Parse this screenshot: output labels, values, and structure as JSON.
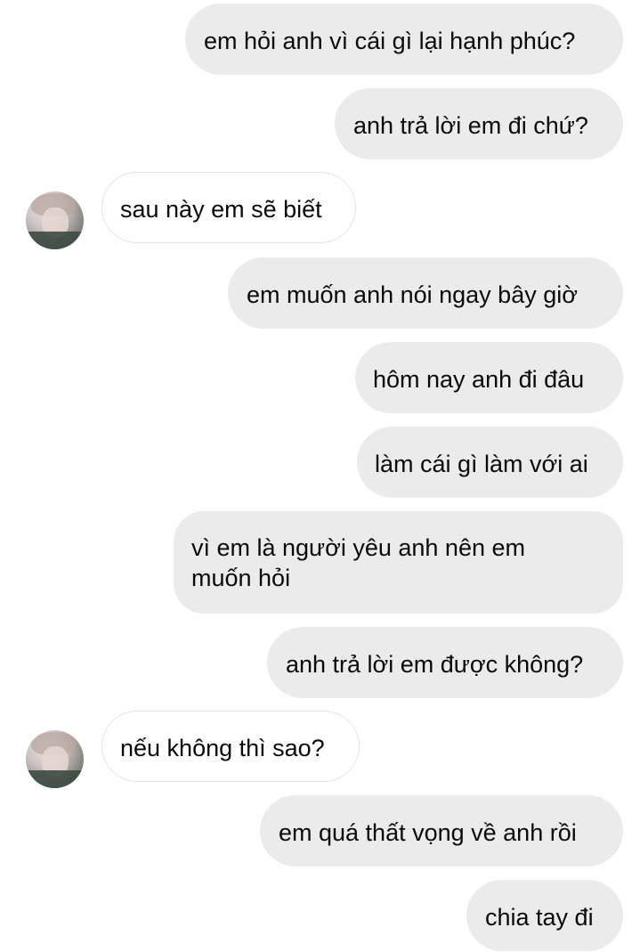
{
  "messages": [
    {
      "side": "sent",
      "text": "em hỏi anh vì cái gì lại hạnh phúc?"
    },
    {
      "side": "sent",
      "text": "anh trả lời em đi chứ?"
    },
    {
      "side": "received",
      "text": "sau này em sẽ biết"
    },
    {
      "side": "sent",
      "text": "em muốn anh nói ngay bây giờ"
    },
    {
      "side": "sent",
      "text": "hôm nay anh đi đâu"
    },
    {
      "side": "sent",
      "text": "làm cái gì làm với ai"
    },
    {
      "side": "sent",
      "line1": "vì em là người yêu anh nên em",
      "line2": "muốn hỏi"
    },
    {
      "side": "sent",
      "text": "anh trả lời em được không?"
    },
    {
      "side": "received",
      "text": "nếu không thì sao?"
    },
    {
      "side": "sent",
      "text": "em quá thất vọng về anh rồi"
    },
    {
      "side": "sent",
      "text": "chia tay đi"
    }
  ],
  "colors": {
    "sent_bubble": "#ebebeb",
    "received_bubble": "#ffffff",
    "received_border": "#e4e4e4",
    "text": "#0a0a0a"
  },
  "icons": {
    "contact_avatar": "profile-photo"
  }
}
